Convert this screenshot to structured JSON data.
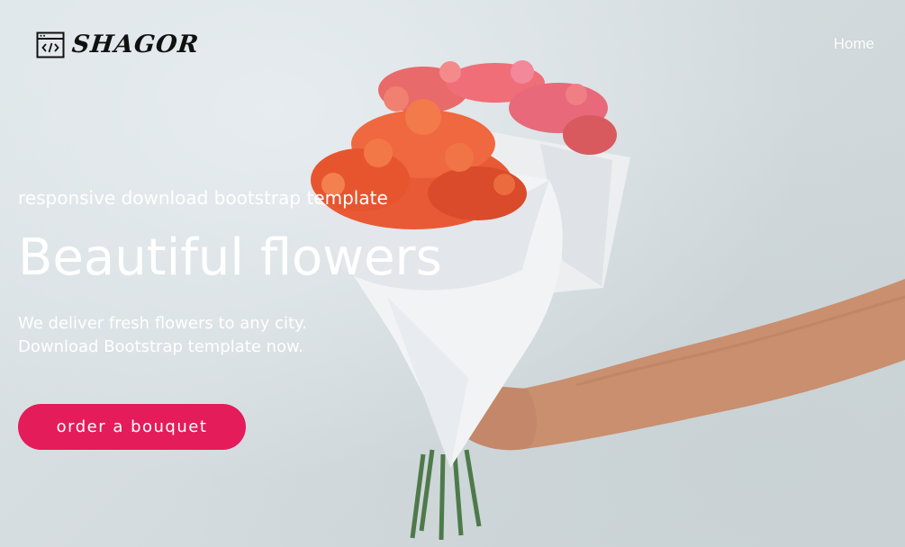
{
  "brand": {
    "name": "SHAGOR",
    "icon": "code-window-icon"
  },
  "nav": {
    "home": "Home"
  },
  "hero": {
    "subtitle": "responsive download bootstrap template",
    "title": "Beautiful flowers",
    "description_line1": "We deliver fresh flowers to any city.",
    "description_line2": "Download Bootstrap template now.",
    "cta_label": "order a bouquet",
    "image": "bouquet-of-flowers-held-by-hand"
  },
  "colors": {
    "accent": "#e41c59",
    "text_light": "#ffffff",
    "background": "#d6dde0"
  }
}
